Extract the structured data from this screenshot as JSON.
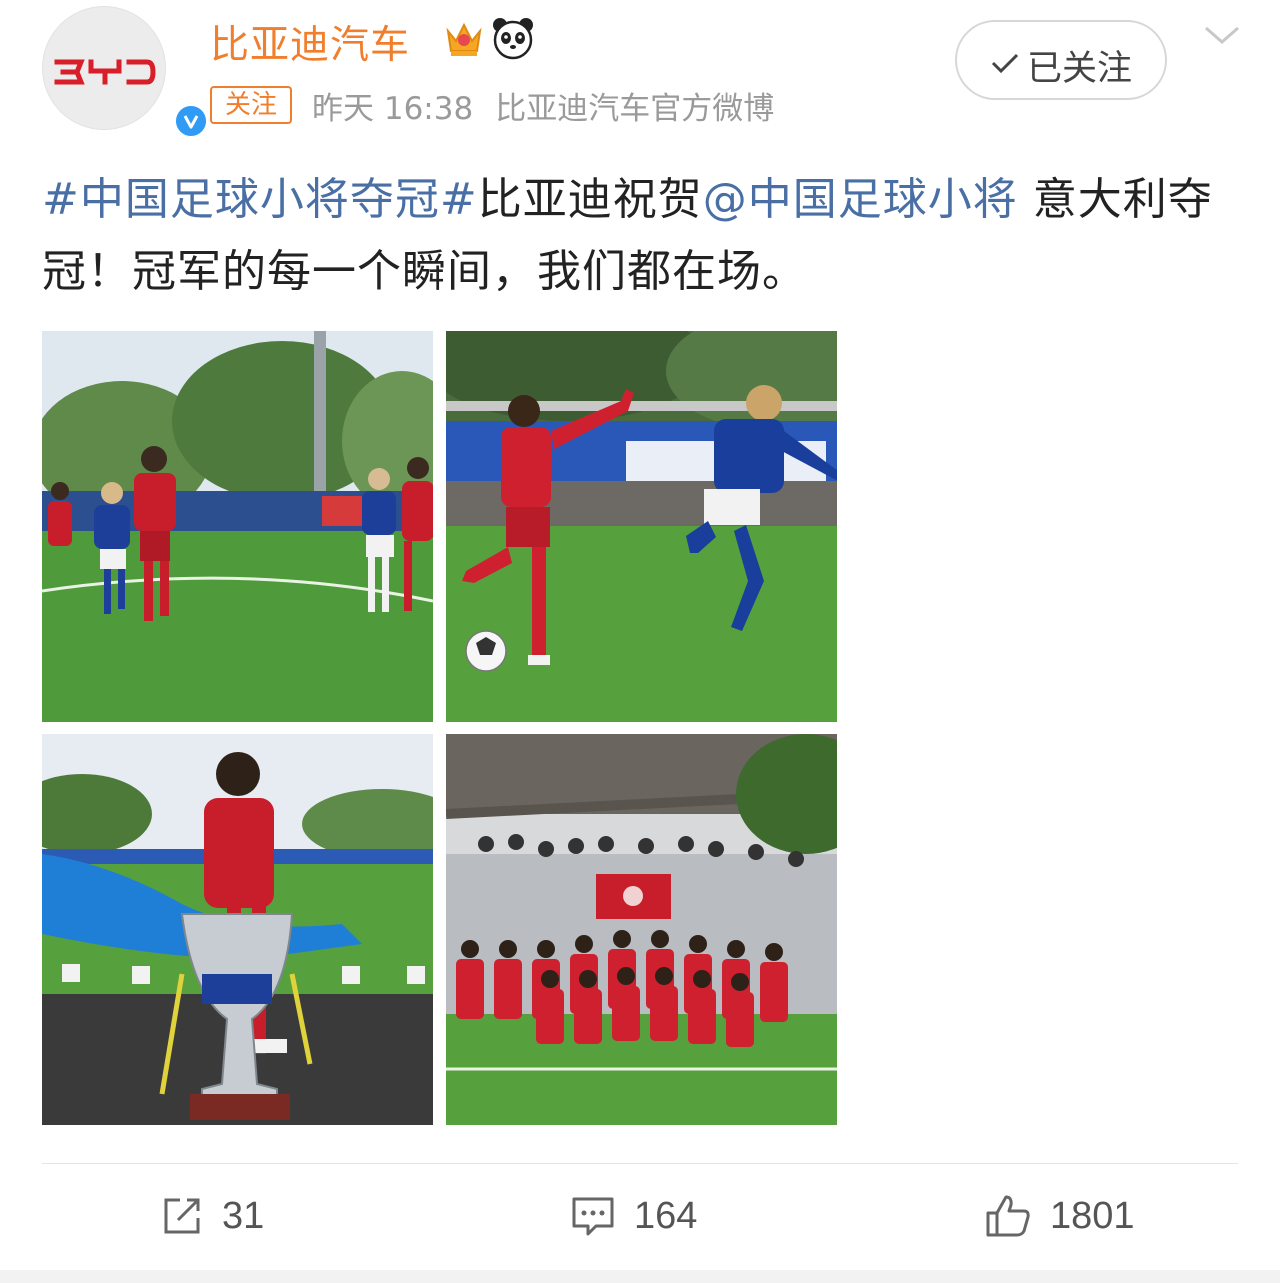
{
  "account": {
    "name": "比亚迪汽车",
    "avatar_logo_text": "BYD",
    "follow_tag": "关注",
    "time": "昨天 16:38",
    "source": "比亚迪汽车官方微博",
    "followed_button": "已关注"
  },
  "post": {
    "hashtag": "#中国足球小将夺冠#",
    "text_1": "比亚迪祝贺",
    "mention": "@中国足球小将",
    "text_2": " 意大利夺冠！冠军的每一个瞬间，我们都在场。"
  },
  "photos": [
    {
      "description": "youth football match, red vs blue"
    },
    {
      "description": "player in red kicking ball, opponent in blue"
    },
    {
      "description": "player holding trophy"
    },
    {
      "description": "team photo in red with flag"
    }
  ],
  "actions": {
    "reposts": "31",
    "comments": "164",
    "likes": "1801"
  },
  "colors": {
    "name_orange": "#f07e2c",
    "link_blue": "#4a6fa5",
    "meta_gray": "#9a9a9a",
    "verified_blue": "#2f9bf5"
  }
}
